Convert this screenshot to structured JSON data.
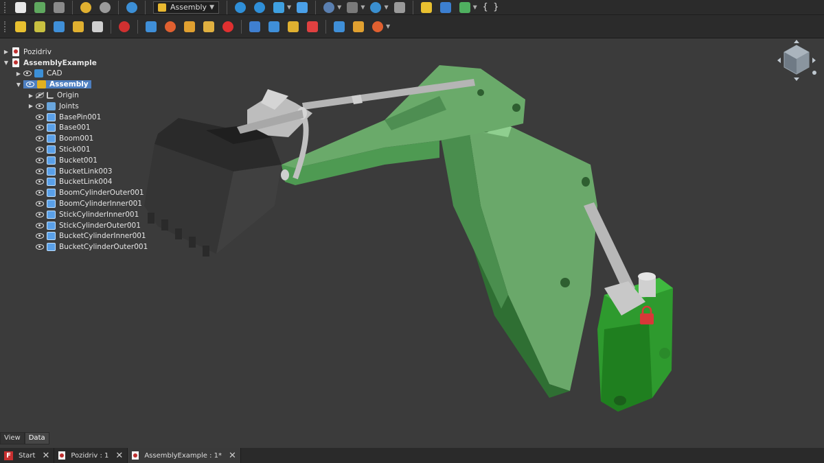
{
  "toolbar_top": {
    "workbench": "Assembly",
    "braces": "{ }"
  },
  "tree": {
    "docs": [
      {
        "label": "Pozidriv"
      },
      {
        "label": "AssemblyExample"
      }
    ],
    "cad": "CAD",
    "assembly": "Assembly",
    "origin": "Origin",
    "joints": "Joints",
    "parts": [
      "BasePin001",
      "Base001",
      "Boom001",
      "Stick001",
      "Bucket001",
      "BucketLink003",
      "BucketLink004",
      "BoomCylinderOuter001",
      "BoomCylinderInner001",
      "StickCylinderInner001",
      "StickCylinderOuter001",
      "BucketCylinderInner001",
      "BucketCylinderOuter001"
    ]
  },
  "panel_tabs": {
    "view": "View",
    "data": "Data"
  },
  "doc_tabs": [
    {
      "label": "Start",
      "close": "✕"
    },
    {
      "label": "Pozidriv : 1",
      "close": "✕"
    },
    {
      "label": "AssemblyExample : 1*",
      "close": "✕"
    }
  ],
  "colors": {
    "boom": "#6aaa6a",
    "stick": "#5b9e5e",
    "base": "#2e9a2e",
    "bucket": "#3a3a3a",
    "cylinder": "#b8b8b8",
    "lock": "#d83838"
  }
}
